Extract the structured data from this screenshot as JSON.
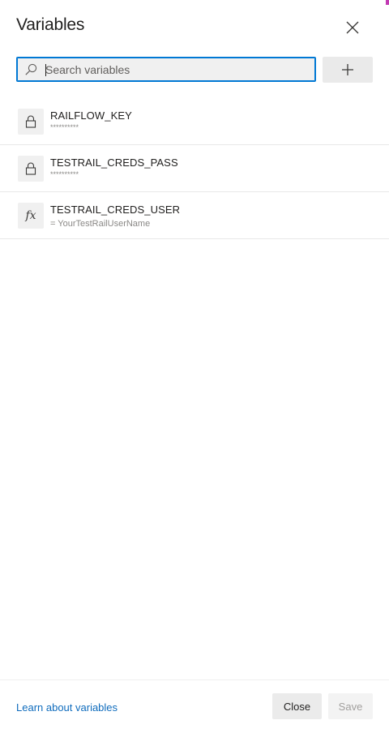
{
  "panel": {
    "title": "Variables",
    "close_icon": "close-icon"
  },
  "search": {
    "placeholder": "Search variables",
    "value": "",
    "icon": "search-icon"
  },
  "add_button": {
    "icon": "plus-icon"
  },
  "variables": [
    {
      "name": "RAILFLOW_KEY",
      "value": "**********",
      "icon": "lock-icon",
      "secret": true
    },
    {
      "name": "TESTRAIL_CREDS_PASS",
      "value": "**********",
      "icon": "lock-icon",
      "secret": true
    },
    {
      "name": "TESTRAIL_CREDS_USER",
      "value": "= YourTestRailUserName",
      "icon": "fx-icon",
      "icon_glyph": "fx",
      "secret": false
    }
  ],
  "footer": {
    "learn_link": "Learn about variables",
    "close_label": "Close",
    "save_label": "Save"
  },
  "colors": {
    "accent": "#0078d4",
    "link": "#0f6cbd",
    "disabled_text": "#a19f9d"
  }
}
